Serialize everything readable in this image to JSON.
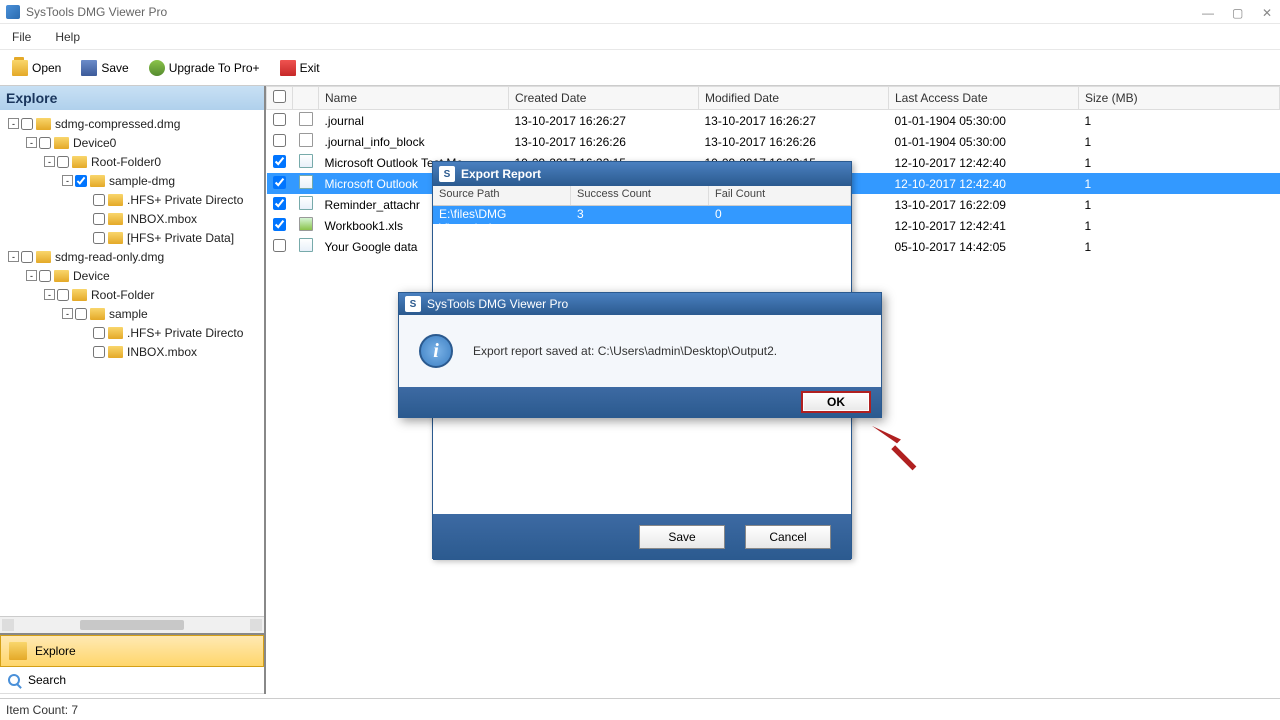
{
  "window": {
    "title": "SysTools DMG Viewer Pro"
  },
  "menu": {
    "file": "File",
    "help": "Help"
  },
  "toolbar": {
    "open": "Open",
    "save": "Save",
    "upgrade": "Upgrade To Pro+",
    "exit": "Exit"
  },
  "sidebar": {
    "header": "Explore",
    "tabs": {
      "explore": "Explore",
      "search": "Search"
    },
    "tree": [
      {
        "indent": 0,
        "exp": "-",
        "label": "sdmg-compressed.dmg"
      },
      {
        "indent": 1,
        "exp": "-",
        "label": "Device0"
      },
      {
        "indent": 2,
        "exp": "-",
        "label": "Root-Folder0"
      },
      {
        "indent": 3,
        "exp": "-",
        "label": "sample-dmg",
        "checked": true
      },
      {
        "indent": 4,
        "exp": "",
        "label": ".HFS+ Private Directo"
      },
      {
        "indent": 4,
        "exp": "",
        "label": "INBOX.mbox"
      },
      {
        "indent": 4,
        "exp": "",
        "label": "[HFS+ Private Data]"
      },
      {
        "indent": 0,
        "exp": "-",
        "label": "sdmg-read-only.dmg"
      },
      {
        "indent": 1,
        "exp": "-",
        "label": "Device"
      },
      {
        "indent": 2,
        "exp": "-",
        "label": "Root-Folder"
      },
      {
        "indent": 3,
        "exp": "-",
        "label": "sample"
      },
      {
        "indent": 4,
        "exp": "",
        "label": ".HFS+ Private Directo"
      },
      {
        "indent": 4,
        "exp": "",
        "label": "INBOX.mbox"
      }
    ]
  },
  "table": {
    "columns": {
      "name": "Name",
      "created": "Created Date",
      "modified": "Modified Date",
      "access": "Last Access Date",
      "size": "Size (MB)"
    },
    "rows": [
      {
        "checked": false,
        "icon": "doc",
        "name": ".journal",
        "created": "13-10-2017 16:26:27",
        "modified": "13-10-2017 16:26:27",
        "access": "01-01-1904 05:30:00",
        "size": "1"
      },
      {
        "checked": false,
        "icon": "doc",
        "name": ".journal_info_block",
        "created": "13-10-2017 16:26:26",
        "modified": "13-10-2017 16:26:26",
        "access": "01-01-1904 05:30:00",
        "size": "1"
      },
      {
        "checked": true,
        "icon": "env",
        "name": "Microsoft Outlook Test Me",
        "created": "10-09-2017 16:22:15",
        "modified": "10-09-2017 16:22:15",
        "access": "12-10-2017 12:42:40",
        "size": "1"
      },
      {
        "checked": true,
        "icon": "env",
        "name": "Microsoft Outlook",
        "created": "",
        "modified": "",
        "access": "12-10-2017 12:42:40",
        "size": "1",
        "selected": true
      },
      {
        "checked": true,
        "icon": "env",
        "name": "Reminder_attachr",
        "created": "",
        "modified": "",
        "access": "13-10-2017 16:22:09",
        "size": "1"
      },
      {
        "checked": true,
        "icon": "xls",
        "name": "Workbook1.xls",
        "created": "",
        "modified": "",
        "access": "12-10-2017 12:42:41",
        "size": "1"
      },
      {
        "checked": false,
        "icon": "env",
        "name": "Your Google data",
        "created": "",
        "modified": "",
        "access": "05-10-2017 14:42:05",
        "size": "1"
      }
    ]
  },
  "exportDlg": {
    "title": "Export Report",
    "cols": {
      "source": "Source Path",
      "success": "Success Count",
      "fail": "Fail Count"
    },
    "row": {
      "source": "E:\\files\\DMG Viewer\\sdmg-...",
      "success": "3",
      "fail": "0"
    },
    "save": "Save",
    "cancel": "Cancel"
  },
  "msgDlg": {
    "title": "SysTools DMG Viewer Pro",
    "text": "Export report saved at: C:\\Users\\admin\\Desktop\\Output2.",
    "ok": "OK"
  },
  "status": {
    "text": "Item Count: 7"
  }
}
